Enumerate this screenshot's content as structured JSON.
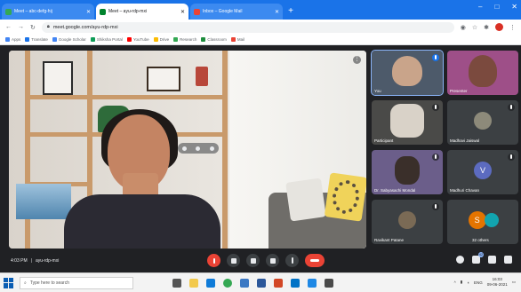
{
  "browser": {
    "tabs": [
      {
        "label": "Meet – abc-defg-hij",
        "active": false,
        "favicon_color": "#34a853"
      },
      {
        "label": "Meet – ayu-rdp-mxi",
        "active": true,
        "favicon_color": "#00832d"
      },
      {
        "label": "Inbox – Google Mail",
        "active": false,
        "favicon_color": "#ea4335"
      }
    ],
    "new_tab": "+",
    "window_controls": [
      "–",
      "□",
      "✕"
    ],
    "url": "meet.google.com/ayu-rdp-mxi",
    "bookmarks": [
      {
        "label": "Apps",
        "color": "#4285f4"
      },
      {
        "label": "Translate",
        "color": "#1a73e8"
      },
      {
        "label": "Google Scholar",
        "color": "#4285f4"
      },
      {
        "label": "Shiksha Portal",
        "color": "#0f9d58"
      },
      {
        "label": "YouTube",
        "color": "#ff0000"
      },
      {
        "label": "Drive",
        "color": "#fbbc04"
      },
      {
        "label": "Research",
        "color": "#34a853"
      },
      {
        "label": "Classroom",
        "color": "#1e8e3e"
      },
      {
        "label": "Mail",
        "color": "#ea4335"
      }
    ]
  },
  "meet": {
    "main_speaker_more": "⋮",
    "participants": [
      {
        "name": "You",
        "avatar_letter": "",
        "avatar_color": "#5f6368",
        "video": true,
        "pinned": true
      },
      {
        "name": "Presenter",
        "avatar_letter": "",
        "avatar_color": "#9e7a6b",
        "video": true,
        "pinned": false
      },
      {
        "name": "Participant",
        "avatar_letter": "",
        "avatar_color": "#c7c2bb",
        "video": true,
        "pinned": false
      },
      {
        "name": "Madhavi Jaiswal",
        "avatar_letter": "",
        "avatar_color": "#8d8a7a",
        "video": false,
        "pinned": false
      },
      {
        "name": "Dr. Sabyasachi Mondal",
        "avatar_letter": "",
        "avatar_color": "#6b5e8a",
        "video": true,
        "pinned": false
      },
      {
        "name": "Madhuri Chavan",
        "avatar_letter": "V",
        "avatar_color": "#5c6bc0",
        "video": false,
        "pinned": false
      },
      {
        "name": "Ravikant Patane",
        "avatar_letter": "",
        "avatar_color": "#7a6a55",
        "video": false,
        "pinned": false
      },
      {
        "name": "32 others",
        "avatar_letter": "S",
        "avatar_color": "#e37400",
        "video": false,
        "pinned": false
      }
    ],
    "bottom": {
      "time": "4:03 PM",
      "separator": "|",
      "meeting_code": "ayu-rdp-mxi",
      "participants_count": "42"
    }
  },
  "taskbar": {
    "search_placeholder": "Type here to search",
    "apps": [
      {
        "name": "task-view",
        "color": "#555555"
      },
      {
        "name": "file-explorer",
        "color": "#f2c94c"
      },
      {
        "name": "edge",
        "color": "#0f7bd8"
      },
      {
        "name": "chrome",
        "color": "#34a853"
      },
      {
        "name": "store",
        "color": "#3b78c3"
      },
      {
        "name": "word",
        "color": "#2b579a"
      },
      {
        "name": "powerpoint",
        "color": "#d24726"
      },
      {
        "name": "mail",
        "color": "#0072c6"
      },
      {
        "name": "photos",
        "color": "#1e88e5"
      },
      {
        "name": "settings",
        "color": "#4a4a4a"
      }
    ],
    "time": "16:03",
    "date": "09-06-2021",
    "lang": "ENG"
  }
}
